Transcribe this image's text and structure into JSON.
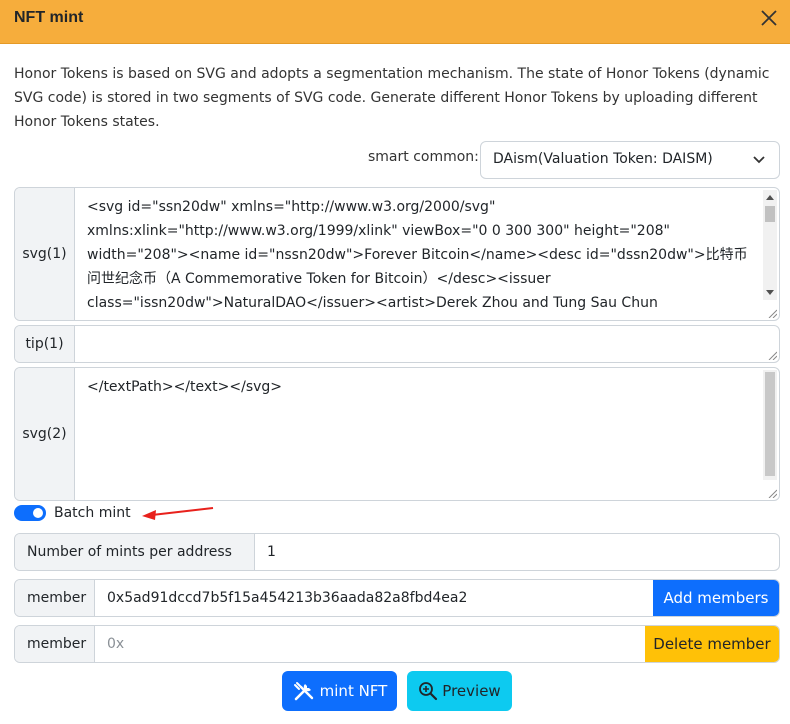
{
  "dialog": {
    "title": "NFT mint",
    "description": "Honor Tokens is based on SVG and adopts a segmentation mechanism. The state of Honor Tokens (dynamic SVG code) is stored in two segments of SVG code. Generate different Honor Tokens by uploading different Honor Tokens states."
  },
  "smart_common": {
    "label": "smart common:",
    "selected": "DAism(Valuation Token: DAISM)"
  },
  "svg1": {
    "label": "svg(1)",
    "value": "<svg id=\"ssn20dw\" xmlns=\"http://www.w3.org/2000/svg\" xmlns:xlink=\"http://www.w3.org/1999/xlink\" viewBox=\"0 0 300 300\" height=\"208\" width=\"208\"><name id=\"nssn20dw\">Forever Bitcoin</name><desc id=\"dssn20dw\">比特币问世纪念币（A Commemorative Token for Bitcoin）</desc><issuer class=\"issn20dw\">NaturalDAO</issuer><artist>Derek Zhou and Tung Sau Chun"
  },
  "tip1": {
    "label": "tip(1)",
    "value": ""
  },
  "svg2": {
    "label": "svg(2)",
    "value": "</textPath></text></svg>"
  },
  "batch": {
    "label": "Batch mint",
    "enabled": true
  },
  "mints": {
    "label": "Number of mints per address",
    "value": "1"
  },
  "member1": {
    "label": "member",
    "value": "0x5ad91dccd7b5f15a454213b36aada82a8fbd4ea2",
    "button": "Add members"
  },
  "member2": {
    "label": "member",
    "placeholder": "0x",
    "button": "Delete member"
  },
  "actions": {
    "mint": "mint NFT",
    "preview": "Preview"
  },
  "colors": {
    "header": "#f6ad3c",
    "primary": "#0d6efd",
    "warning": "#ffc107",
    "info": "#0dcaf0",
    "annotation": "#e8211c"
  }
}
